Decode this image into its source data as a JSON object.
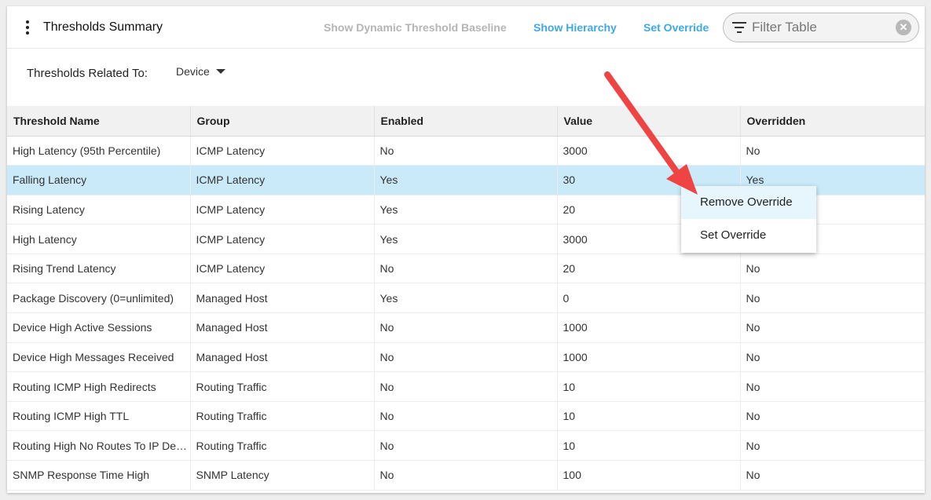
{
  "header": {
    "title": "Thresholds Summary",
    "links": {
      "dynamic_baseline": "Show Dynamic Threshold Baseline",
      "hierarchy": "Show Hierarchy",
      "set_override": "Set Override"
    },
    "filter_placeholder": "Filter Table",
    "clear_glyph": "✕"
  },
  "related": {
    "label": "Thresholds Related To:",
    "value": "Device"
  },
  "table": {
    "columns": [
      "Threshold Name",
      "Group",
      "Enabled",
      "Value",
      "Overridden"
    ],
    "rows": [
      [
        "High Latency (95th Percentile)",
        "ICMP Latency",
        "No",
        "3000",
        "No"
      ],
      [
        "Falling Latency",
        "ICMP Latency",
        "Yes",
        "30",
        "Yes"
      ],
      [
        "Rising Latency",
        "ICMP Latency",
        "Yes",
        "20",
        ""
      ],
      [
        "High Latency",
        "ICMP Latency",
        "Yes",
        "3000",
        ""
      ],
      [
        "Rising Trend Latency",
        "ICMP Latency",
        "No",
        "20",
        "No"
      ],
      [
        "Package Discovery (0=unlimited)",
        "Managed Host",
        "Yes",
        "0",
        "No"
      ],
      [
        "Device High Active Sessions",
        "Managed Host",
        "No",
        "1000",
        "No"
      ],
      [
        "Device High Messages Received",
        "Managed Host",
        "No",
        "1000",
        "No"
      ],
      [
        "Routing ICMP High Redirects",
        "Routing Traffic",
        "No",
        "10",
        "No"
      ],
      [
        "Routing ICMP High TTL",
        "Routing Traffic",
        "No",
        "10",
        "No"
      ],
      [
        "Routing High No Routes To IP Destination",
        "Routing Traffic",
        "No",
        "10",
        "No"
      ],
      [
        "SNMP Response Time High",
        "SNMP Latency",
        "No",
        "100",
        "No"
      ]
    ],
    "selected_row": 1
  },
  "context_menu": {
    "items": [
      "Remove Override",
      "Set Override"
    ]
  },
  "colors": {
    "accent": "#3fa9e6",
    "selected_row": "#cbeaf9",
    "annotation_arrow": "#ee4444"
  },
  "icons": {
    "menu": "more-vert-icon",
    "filter": "filter-icon",
    "clear": "clear-icon",
    "dropdown": "caret-down-icon",
    "annotation": "red-arrow-annotation"
  }
}
